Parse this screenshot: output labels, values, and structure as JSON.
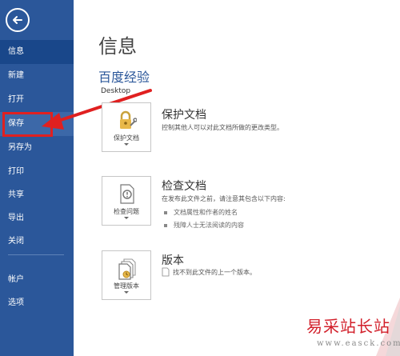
{
  "nav": {
    "back_icon": "arrow-left-icon",
    "items": [
      {
        "label": "信息"
      },
      {
        "label": "新建"
      },
      {
        "label": "打开"
      },
      {
        "label": "保存"
      },
      {
        "label": "另存为"
      },
      {
        "label": "打印"
      },
      {
        "label": "共享"
      },
      {
        "label": "导出"
      },
      {
        "label": "关闭"
      },
      {
        "label": "帐户"
      },
      {
        "label": "选项"
      }
    ]
  },
  "main": {
    "title": "信息",
    "doc_name": "百度经验",
    "doc_location": "Desktop",
    "sections": [
      {
        "tile_label": "保护文档",
        "icon": "lock-key-icon",
        "title": "保护文档",
        "description": "控制其他人可以对此文档所做的更改类型。",
        "bullets": []
      },
      {
        "tile_label": "检查问题",
        "icon": "document-check-icon",
        "title": "检查文档",
        "description": "在发布此文件之前，请注意其包含以下内容:",
        "bullets": [
          "文档属性和作者的姓名",
          "残障人士无法阅读的内容"
        ]
      },
      {
        "tile_label": "管理版本",
        "icon": "document-versions-icon",
        "title": "版本",
        "description": "找不到此文件的上一个版本。",
        "bullets": []
      }
    ]
  },
  "watermark": {
    "logo_text": "易采站长站",
    "url_text": "www.easck.com"
  },
  "colors": {
    "sidebar": "#2b579a",
    "accent": "#2b579a",
    "highlight": "#e02020"
  }
}
